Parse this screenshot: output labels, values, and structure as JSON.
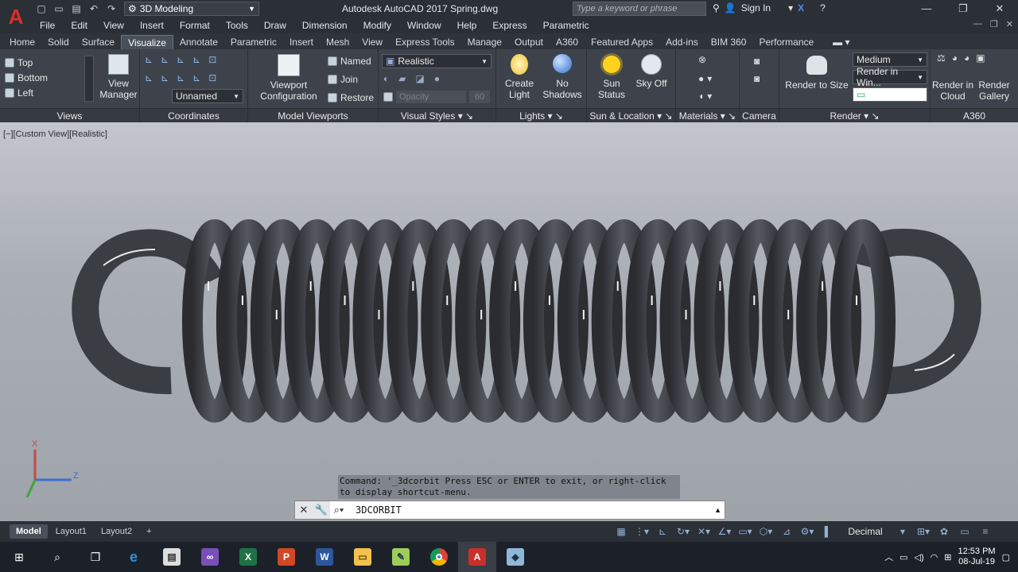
{
  "app": {
    "logo": "A",
    "title": "Autodesk AutoCAD 2017    Spring.dwg",
    "workspace": "3D Modeling",
    "search_placeholder": "Type a keyword or phrase",
    "signin": "Sign In"
  },
  "menu": [
    "File",
    "Edit",
    "View",
    "Insert",
    "Format",
    "Tools",
    "Draw",
    "Dimension",
    "Modify",
    "Window",
    "Help",
    "Express",
    "Parametric"
  ],
  "tabs": [
    "Home",
    "Solid",
    "Surface",
    "Visualize",
    "Annotate",
    "Parametric",
    "Insert",
    "Mesh",
    "View",
    "Express Tools",
    "Manage",
    "Output",
    "A360",
    "Featured Apps",
    "Add-ins",
    "BIM 360",
    "Performance"
  ],
  "active_tab": "Visualize",
  "ribbon": {
    "views": {
      "items": [
        "Top",
        "Bottom",
        "Left"
      ],
      "view_manager": "View\nManager",
      "label": "Views"
    },
    "coordinates": {
      "ucs": "Unnamed",
      "label": "Coordinates"
    },
    "model_viewports": {
      "config": "Viewport\nConfiguration",
      "named": "Named",
      "join": "Join",
      "restore": "Restore",
      "label": "Model Viewports"
    },
    "visual_styles": {
      "style": "Realistic",
      "opacity_label": "Opacity",
      "opacity_value": "60",
      "label": "Visual Styles"
    },
    "lights": {
      "create": "Create\nLight",
      "shadows": "No\nShadows",
      "label": "Lights"
    },
    "sun": {
      "status": "Sun\nStatus",
      "sky": "Sky Off",
      "label": "Sun & Location"
    },
    "materials": {
      "label": "Materials"
    },
    "camera": {
      "label": "Camera"
    },
    "render": {
      "quality": "Medium",
      "target": "Render in Win...",
      "render_to_size": "Render to Size",
      "label": "Render"
    },
    "a360": {
      "cloud": "Render in\nCloud",
      "gallery": "Render\nGallery",
      "label": "A360"
    }
  },
  "viewport": {
    "label": "[−][Custom View][Realistic]"
  },
  "command": {
    "history": "Command: '_3dcorbit Press ESC or ENTER to exit, or right-click to display shortcut-menu.",
    "current": "3DCORBIT"
  },
  "layouts": [
    "Model",
    "Layout1",
    "Layout2"
  ],
  "status": {
    "units": "Decimal"
  },
  "taskbar": {
    "time": "12:53 PM",
    "date": "08-Jul-19"
  },
  "colors": {
    "accent": "#d9302a",
    "ribbon": "#3e434b",
    "viewport_top": "#c3c6cc",
    "spring": "#3e4146"
  }
}
